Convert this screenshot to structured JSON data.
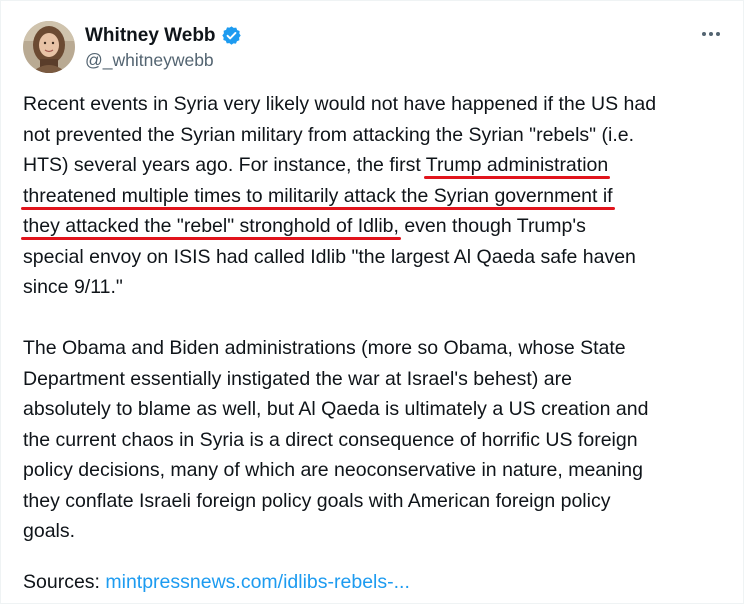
{
  "author": {
    "display_name": "Whitney Webb",
    "handle": "@_whitneywebb",
    "avatar_icon": "avatar-portrait",
    "verified": true,
    "verified_color": "#1d9bf0"
  },
  "more_button_icon": "more-horizontal-icon",
  "paragraph1": {
    "l1": "Recent events in Syria very likely would not have happened if the US had",
    "l2": "not prevented the Syrian military from attacking the Syrian \"rebels\" (i.e.",
    "l3_pre": "HTS) several years ago. For instance, the first ",
    "l3_hl": "Trump administration",
    "l4_hl": "threatened multiple times to militarily attack the Syrian government if",
    "l5_hl": "they attacked the \"rebel\" stronghold of Idlib,",
    "l5_post": " even though Trump's",
    "l6": "special envoy on ISIS had called Idlib \"the largest Al Qaeda safe haven",
    "l7": "since 9/11.\""
  },
  "paragraph2": {
    "l1": "The Obama and Biden administrations (more so Obama, whose State",
    "l2": "Department essentially instigated the war at Israel's behest) are",
    "l3": "absolutely to blame as well, but Al Qaeda is ultimately a US creation and",
    "l4": "the current chaos in Syria is a direct consequence of horrific US foreign",
    "l5": "policy decisions, many of which are neoconservative in nature, meaning",
    "l6": "they conflate Israeli foreign policy goals with American foreign policy",
    "l7": "goals."
  },
  "sources": {
    "label": "Sources: ",
    "link_text": "mintpressnews.com/idlibs-rebels-..."
  },
  "colors": {
    "text": "#0f1419",
    "secondary": "#536471",
    "link": "#1d9bf0",
    "annotation_underline": "#e1141c"
  }
}
